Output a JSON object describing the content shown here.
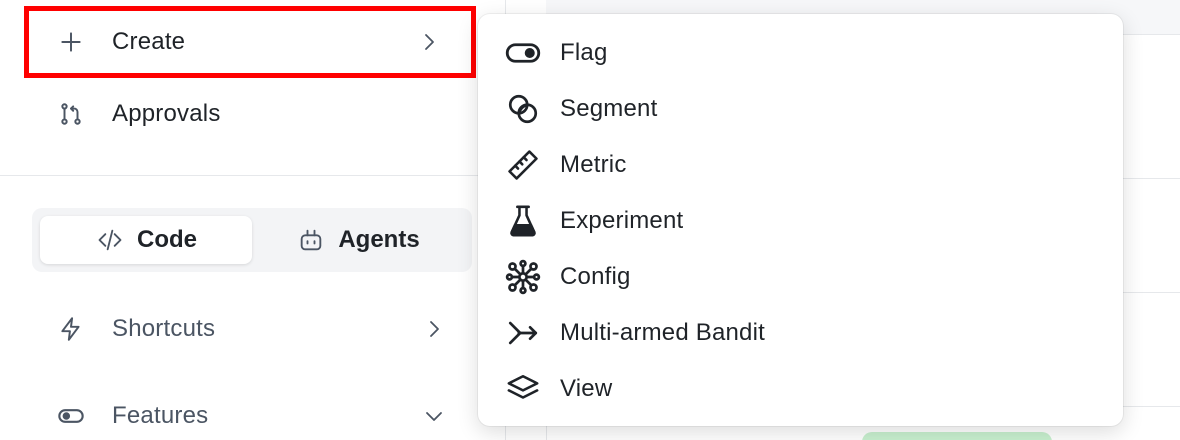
{
  "sidebar": {
    "create": {
      "label": "Create",
      "icon": "plus-icon"
    },
    "approvals": {
      "label": "Approvals",
      "icon": "git-pull-request-icon"
    },
    "mode_tabs": [
      {
        "label": "Code",
        "icon": "code-icon",
        "active": true
      },
      {
        "label": "Agents",
        "icon": "bot-icon",
        "active": false
      }
    ],
    "shortcuts": {
      "label": "Shortcuts",
      "icon": "lightning-icon"
    },
    "features": {
      "label": "Features",
      "icon": "toggle-icon"
    }
  },
  "create_menu": {
    "items": [
      {
        "label": "Flag",
        "icon": "toggle-icon"
      },
      {
        "label": "Segment",
        "icon": "segment-icon"
      },
      {
        "label": "Metric",
        "icon": "ruler-icon"
      },
      {
        "label": "Experiment",
        "icon": "flask-icon"
      },
      {
        "label": "Config",
        "icon": "config-icon"
      },
      {
        "label": "Multi-armed Bandit",
        "icon": "bandit-icon"
      },
      {
        "label": "View",
        "icon": "layers-icon"
      }
    ]
  },
  "colors": {
    "highlight_border": "#ff0000",
    "text": "#1f2328",
    "muted_text": "#4b5563",
    "status_pill": "#c8f0cf"
  }
}
